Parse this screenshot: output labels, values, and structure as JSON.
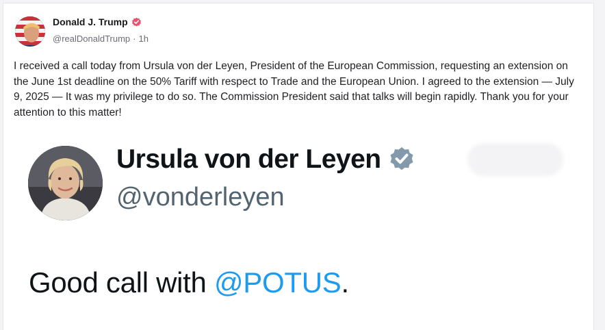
{
  "post": {
    "author_name": "Donald J. Trump",
    "author_handle": "@realDonaldTrump",
    "separator": "·",
    "time_ago": "1h",
    "text": "I received a call today from Ursula von der Leyen, President of the European Commission, requesting an extension on the June 1st deadline on the 50% Tariff with respect to Trade and the European Union. I agreed to the extension — July 9, 2025 — It was my privilege to do so. The Commission President said that talks will begin rapidly. Thank you for your attention to this matter!"
  },
  "embedded": {
    "name": "Ursula von der Leyen",
    "handle": "@vonderleyen",
    "tweet_prefix": "Good call with ",
    "tweet_mention": "@POTUS",
    "tweet_suffix": "."
  },
  "colors": {
    "verified_badge": "#f0506e",
    "embedded_verified": "#829aab",
    "mention": "#1d9bf0"
  },
  "icons": {
    "author_verified": "verified-badge-icon",
    "embedded_verified": "verified-check-icon"
  }
}
